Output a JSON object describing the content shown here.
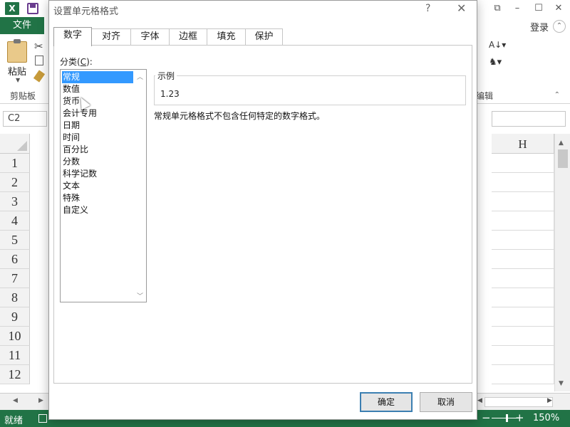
{
  "excel": {
    "app_icon_text": "X",
    "file_tab": "文件",
    "login": "登录",
    "paste_label": "粘贴",
    "clipboard_group": "剪贴板",
    "editing_group": "编辑",
    "name_box": "C2",
    "column_header": "H",
    "row_numbers": [
      "1",
      "2",
      "3",
      "4",
      "5",
      "6",
      "7",
      "8",
      "9",
      "10",
      "11",
      "12"
    ],
    "status_ready": "就绪",
    "zoom_level": "150%",
    "brand_color": "#217346"
  },
  "dialog": {
    "title": "设置单元格格式",
    "help_icon": "?",
    "close_icon": "✕",
    "tabs": [
      {
        "label": "数字",
        "active": true
      },
      {
        "label": "对齐",
        "active": false
      },
      {
        "label": "字体",
        "active": false
      },
      {
        "label": "边框",
        "active": false
      },
      {
        "label": "填充",
        "active": false
      },
      {
        "label": "保护",
        "active": false
      }
    ],
    "category_label_prefix": "分类(",
    "category_label_key": "C",
    "category_label_suffix": "):",
    "categories": [
      "常规",
      "数值",
      "货币",
      "会计专用",
      "日期",
      "时间",
      "百分比",
      "分数",
      "科学记数",
      "文本",
      "特殊",
      "自定义"
    ],
    "selected_category": "常规",
    "sample_legend": "示例",
    "sample_value": "1.23",
    "description": "常规单元格格式不包含任何特定的数字格式。",
    "ok_button": "确定",
    "cancel_button": "取消",
    "selection_color": "#3399ff"
  }
}
